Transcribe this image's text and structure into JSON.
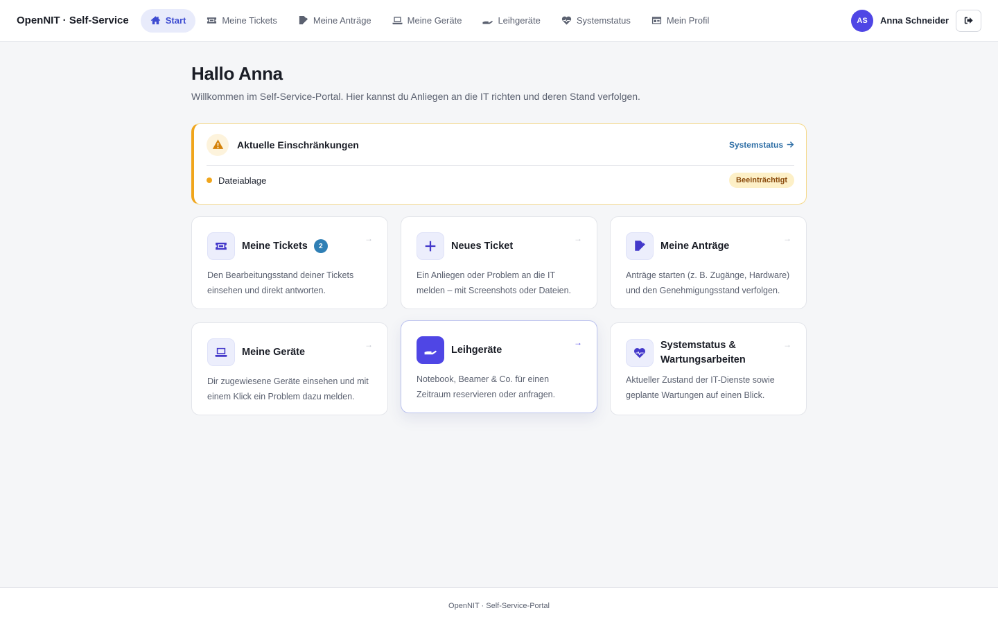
{
  "app": {
    "brand": "OpenNIT · Self-Service"
  },
  "nav": {
    "items": [
      {
        "label": "Start",
        "icon": "home-icon",
        "active": true
      },
      {
        "label": "Meine Tickets",
        "icon": "ticket-icon"
      },
      {
        "label": "Meine Anträge",
        "icon": "edit-document-icon"
      },
      {
        "label": "Meine Geräte",
        "icon": "laptop-icon"
      },
      {
        "label": "Leihgeräte",
        "icon": "hand-holding-icon"
      },
      {
        "label": "Systemstatus",
        "icon": "heart-pulse-icon"
      },
      {
        "label": "Mein Profil",
        "icon": "id-card-icon"
      }
    ]
  },
  "user": {
    "initials": "AS",
    "name": "Anna Schneider"
  },
  "page": {
    "greeting": "Hallo Anna",
    "welcome": "Willkommen im Self-Service-Portal. Hier kannst du Anliegen an die IT richten und deren Stand verfolgen."
  },
  "alert": {
    "title": "Aktuelle Einschränkungen",
    "link_label": "Systemstatus",
    "items": [
      {
        "service": "Dateiablage",
        "status": "Beeinträchtigt"
      }
    ],
    "colors": {
      "accent": "#f0a51b",
      "badge_bg": "#fdf0c7",
      "badge_text": "#8a4b0d"
    }
  },
  "cards": [
    {
      "title": "Meine Tickets",
      "badge": "2",
      "icon": "ticket-icon",
      "desc": "Den Bearbeitungsstand deiner Tickets einsehen und direkt antworten.",
      "arrow": "→"
    },
    {
      "title": "Neues Ticket",
      "icon": "plus-icon",
      "desc": "Ein Anliegen oder Problem an die IT melden – mit Screenshots oder Dateien.",
      "arrow": "→"
    },
    {
      "title": "Meine Anträge",
      "icon": "edit-document-icon",
      "desc": "Anträge starten (z. B. Zugänge, Hardware) und den Genehmigungsstand verfolgen.",
      "arrow": "→"
    },
    {
      "title": "Meine Geräte",
      "icon": "laptop-icon",
      "desc": "Dir zugewiesene Geräte einsehen und mit einem Klick ein Problem dazu melden.",
      "arrow": "→"
    },
    {
      "title": "Leihgeräte",
      "icon": "hand-holding-icon",
      "desc": "Notebook, Beamer & Co. für einen Zeitraum reservieren oder anfragen.",
      "arrow": "→"
    },
    {
      "title": "Systemstatus & Wartungsarbeiten",
      "icon": "heart-pulse-icon",
      "desc": "Aktueller Zustand der IT-Dienste sowie geplante Wartungen auf einen Blick.",
      "arrow": "→"
    }
  ],
  "footer": {
    "text": "OpenNIT · Self-Service-Portal"
  },
  "colors": {
    "primary": "#4f46e5",
    "nav_active_bg": "#e8ebfb",
    "link": "#2f6fa6",
    "count_badge": "#2f7fb5"
  }
}
